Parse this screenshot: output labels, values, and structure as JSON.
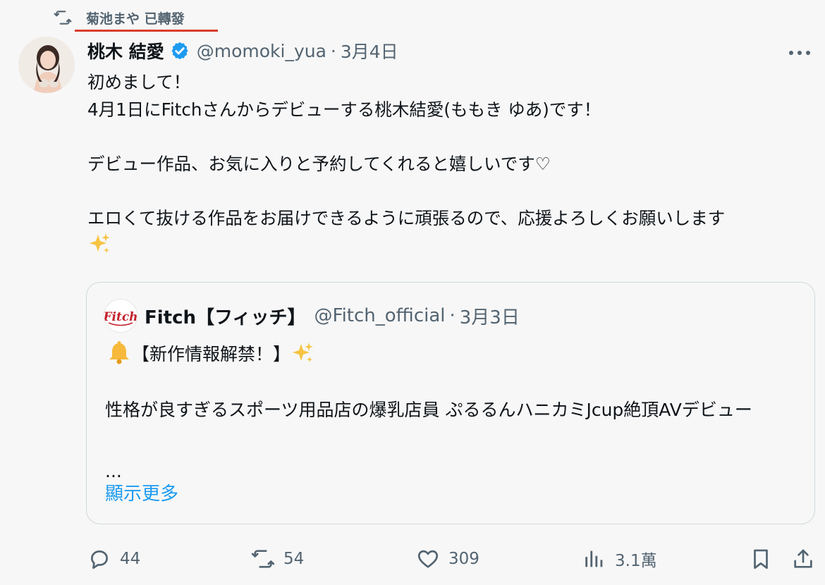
{
  "retweet": {
    "text": "菊池まや 已轉發",
    "icon": "retweet-icon"
  },
  "author": {
    "display_name": "桃木 結愛",
    "handle": "@momoki_yua",
    "separator": "·",
    "date": "3月4日",
    "verified_color": "#1d9bf0"
  },
  "body": {
    "line1": "初めまして！",
    "line2": "4月1日にFitchさんからデビューする桃木結愛(ももき ゆあ)です！",
    "line3": "デビュー作品、お気に入りと予約してくれると嬉しいです♡",
    "line4": "エロくて抜ける作品をお届けできるように頑張るので、応援よろしくお願いします"
  },
  "quote": {
    "display_name": "Fitch【フィッチ】",
    "handle": "@Fitch_official",
    "separator": "·",
    "date": "3月3日",
    "headline": "【新作情報解禁！】",
    "text": "性格が良すぎるスポーツ用品店の爆乳店員 ぷるるんハニカミJcup絶頂AVデビュー",
    "ellipsis": "...",
    "show_more": "顯示更多",
    "logo_text": "Fitch"
  },
  "actions": {
    "reply_count": "44",
    "retweet_count": "54",
    "like_count": "309",
    "views_count": "3.1萬"
  },
  "colors": {
    "accent": "#1d9bf0",
    "secondary_text": "#536471",
    "underline": "#d93d2c",
    "background": "#f7f7f7"
  }
}
